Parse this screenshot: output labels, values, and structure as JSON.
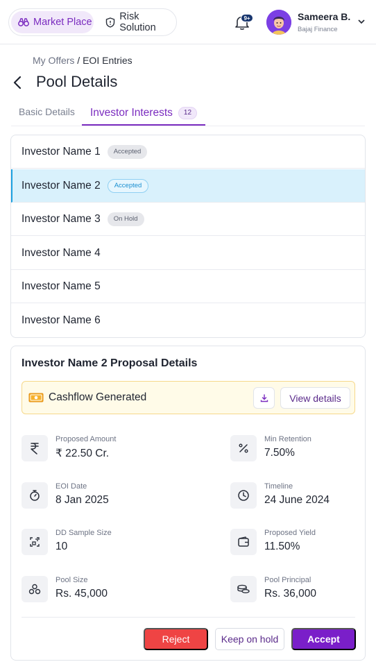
{
  "header": {
    "nav": [
      {
        "label": "Market Place",
        "icon": "binoculars-icon",
        "active": true
      },
      {
        "label": "Risk Solution",
        "icon": "shield-icon",
        "active": false
      }
    ],
    "notification_badge": "9+",
    "user": {
      "name": "Sameera B.",
      "org": "Bajaj Finance"
    }
  },
  "breadcrumb": {
    "parent": "My Offers",
    "separator": " / ",
    "current": "EOI Entries"
  },
  "page_title": "Pool Details",
  "tabs": {
    "basic": "Basic Details",
    "investor": "Investor Interests",
    "investor_count": "12"
  },
  "investors": [
    {
      "name": "Investor Name 1",
      "status": "Accepted"
    },
    {
      "name": "Investor Name 2",
      "status": "Accepted",
      "selected": true
    },
    {
      "name": "Investor Name 3",
      "status": "On Hold"
    },
    {
      "name": "Investor Name 4",
      "status": ""
    },
    {
      "name": "Investor Name 5",
      "status": ""
    },
    {
      "name": "Investor Name 6",
      "status": ""
    }
  ],
  "proposal": {
    "title": "Investor Name 2 Proposal Details",
    "cashflow_label": "Cashflow Generated",
    "view_details_label": "View details",
    "stats": [
      {
        "label": "Proposed Amount",
        "value": "₹ 22.50 Cr.",
        "icon": "rupee-icon"
      },
      {
        "label": "Min Retention",
        "value": "7.50%",
        "icon": "percent-icon"
      },
      {
        "label": "EOI Date",
        "value": "8 Jan 2025",
        "icon": "stopwatch-icon"
      },
      {
        "label": "Timeline",
        "value": "24 June 2024",
        "icon": "clock-icon"
      },
      {
        "label": "DD Sample Size",
        "value": "10",
        "icon": "sample-icon"
      },
      {
        "label": "Proposed Yield",
        "value": "11.50%",
        "icon": "wallet-icon"
      },
      {
        "label": "Pool Size",
        "value": "Rs. 45,000",
        "icon": "pool-icon"
      },
      {
        "label": "Pool Principal",
        "value": "Rs. 36,000",
        "icon": "coins-icon"
      }
    ],
    "actions": {
      "reject": "Reject",
      "hold": "Keep on hold",
      "accept": "Accept"
    }
  },
  "colors": {
    "accent": "#7a1fc9",
    "danger": "#ef4444",
    "selected_row": "#d9f1fc",
    "cashflow_bg": "#fffbe8"
  }
}
